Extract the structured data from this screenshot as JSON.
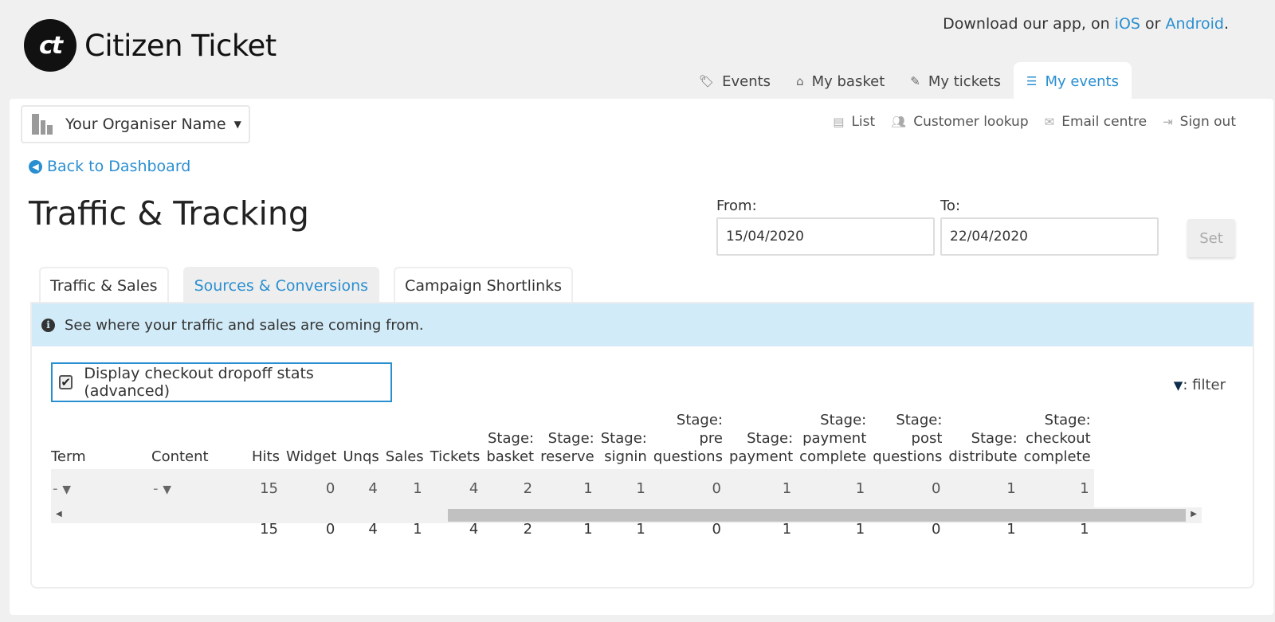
{
  "brand": {
    "mark": "ct",
    "name": "Citizen Ticket"
  },
  "promo": {
    "prefix": "Download our app, on ",
    "ios": "iOS",
    "mid": " or ",
    "android": "Android",
    "suffix": "."
  },
  "nav": {
    "events": "Events",
    "basket": "My basket",
    "tickets": "My tickets",
    "my_events": "My events"
  },
  "organiser": {
    "name": "Your Organiser Name"
  },
  "subnav": {
    "list": "List",
    "lookup": "Customer lookup",
    "email": "Email centre",
    "signout": "Sign out"
  },
  "back_link": "Back to Dashboard",
  "title": "Traffic & Tracking",
  "dates": {
    "from_label": "From:",
    "from_value": "15/04/2020",
    "to_label": "To:",
    "to_value": "22/04/2020",
    "set_label": "Set"
  },
  "tabs": {
    "traffic": "Traffic & Sales",
    "sources": "Sources & Conversions",
    "campaign": "Campaign Shortlinks"
  },
  "info_text": "See where your traffic and sales are coming from.",
  "checkbox": {
    "label": "Display checkout dropoff stats (advanced)",
    "checked": true
  },
  "filter_label": ": filter",
  "table": {
    "headers": {
      "term": "Term",
      "content": "Content",
      "hits": "Hits",
      "widget": "Widget",
      "unqs": "Unqs",
      "sales": "Sales",
      "tickets": "Tickets",
      "basket_a": "Stage:",
      "basket_b": "basket",
      "reserve_a": "Stage:",
      "reserve_b": "reserve",
      "signin_a": "Stage:",
      "signin_b": "signin",
      "preq_a": "Stage:",
      "preq_b": "pre",
      "preq_c": "questions",
      "payment_a": "Stage:",
      "payment_b": "payment",
      "paycomp_a": "Stage:",
      "paycomp_b": "payment",
      "paycomp_c": "complete",
      "postq_a": "Stage:",
      "postq_b": "post",
      "postq_c": "questions",
      "distribute_a": "Stage:",
      "distribute_b": "distribute",
      "chkcomp_a": "Stage:",
      "chkcomp_b": "checkout",
      "chkcomp_c": "complete"
    },
    "filter_row": {
      "term": "-",
      "content": "-",
      "hits": "15",
      "widget": "0",
      "unqs": "4",
      "sales": "1",
      "tickets": "4",
      "basket": "2",
      "reserve": "1",
      "signin": "1",
      "preq": "0",
      "payment": "1",
      "paycomp": "1",
      "postq": "0",
      "distribute": "1",
      "chkcomp": "1"
    },
    "total_row": {
      "hits": "15",
      "widget": "0",
      "unqs": "4",
      "sales": "1",
      "tickets": "4",
      "basket": "2",
      "reserve": "1",
      "signin": "1",
      "preq": "0",
      "payment": "1",
      "paycomp": "1",
      "postq": "0",
      "distribute": "1",
      "chkcomp": "1"
    }
  },
  "colors": {
    "accent": "#2a8fd0",
    "info_bg": "#d2ebf8",
    "page_bg": "#f0f0f0"
  }
}
